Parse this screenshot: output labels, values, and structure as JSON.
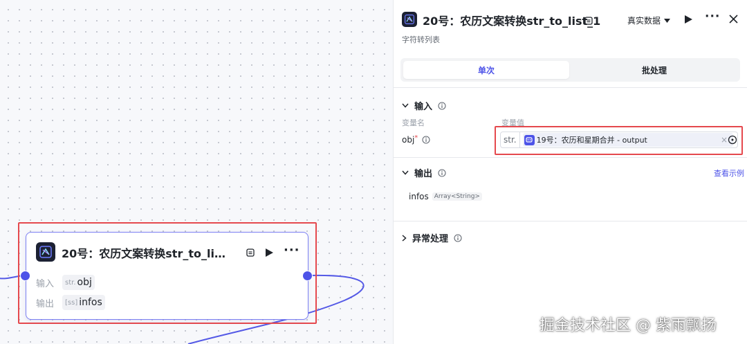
{
  "node": {
    "title": "20号：农历文案转换str_to_li…",
    "input_label": "输入",
    "output_label": "输出",
    "input_type": "str.",
    "input_name": "obj",
    "output_type": "[ss]",
    "output_name": "infos"
  },
  "panel": {
    "title": "20号：农历文案转换str_to_list_1",
    "data_select": "真实数据",
    "subtitle": "字符转列表",
    "tabs": [
      "单次",
      "批处理"
    ],
    "input_section": {
      "title": "输入",
      "col_name": "变量名",
      "col_value": "变量值",
      "var_name": "obj",
      "required_mark": "*",
      "var_type": "str.",
      "ref_text": "19号：农历和星期合并 - output",
      "clear_icon": "×"
    },
    "output_section": {
      "title": "输出",
      "view_example": "查看示例",
      "var_name": "infos",
      "var_type": "Array<String>"
    },
    "exception_section": {
      "title": "异常处理"
    }
  },
  "watermark": "掘金技术社区 @ 紫雨飘扬",
  "colors": {
    "accent": "#4d53e8",
    "highlight": "#e5484d",
    "edge": "#5459e6"
  }
}
